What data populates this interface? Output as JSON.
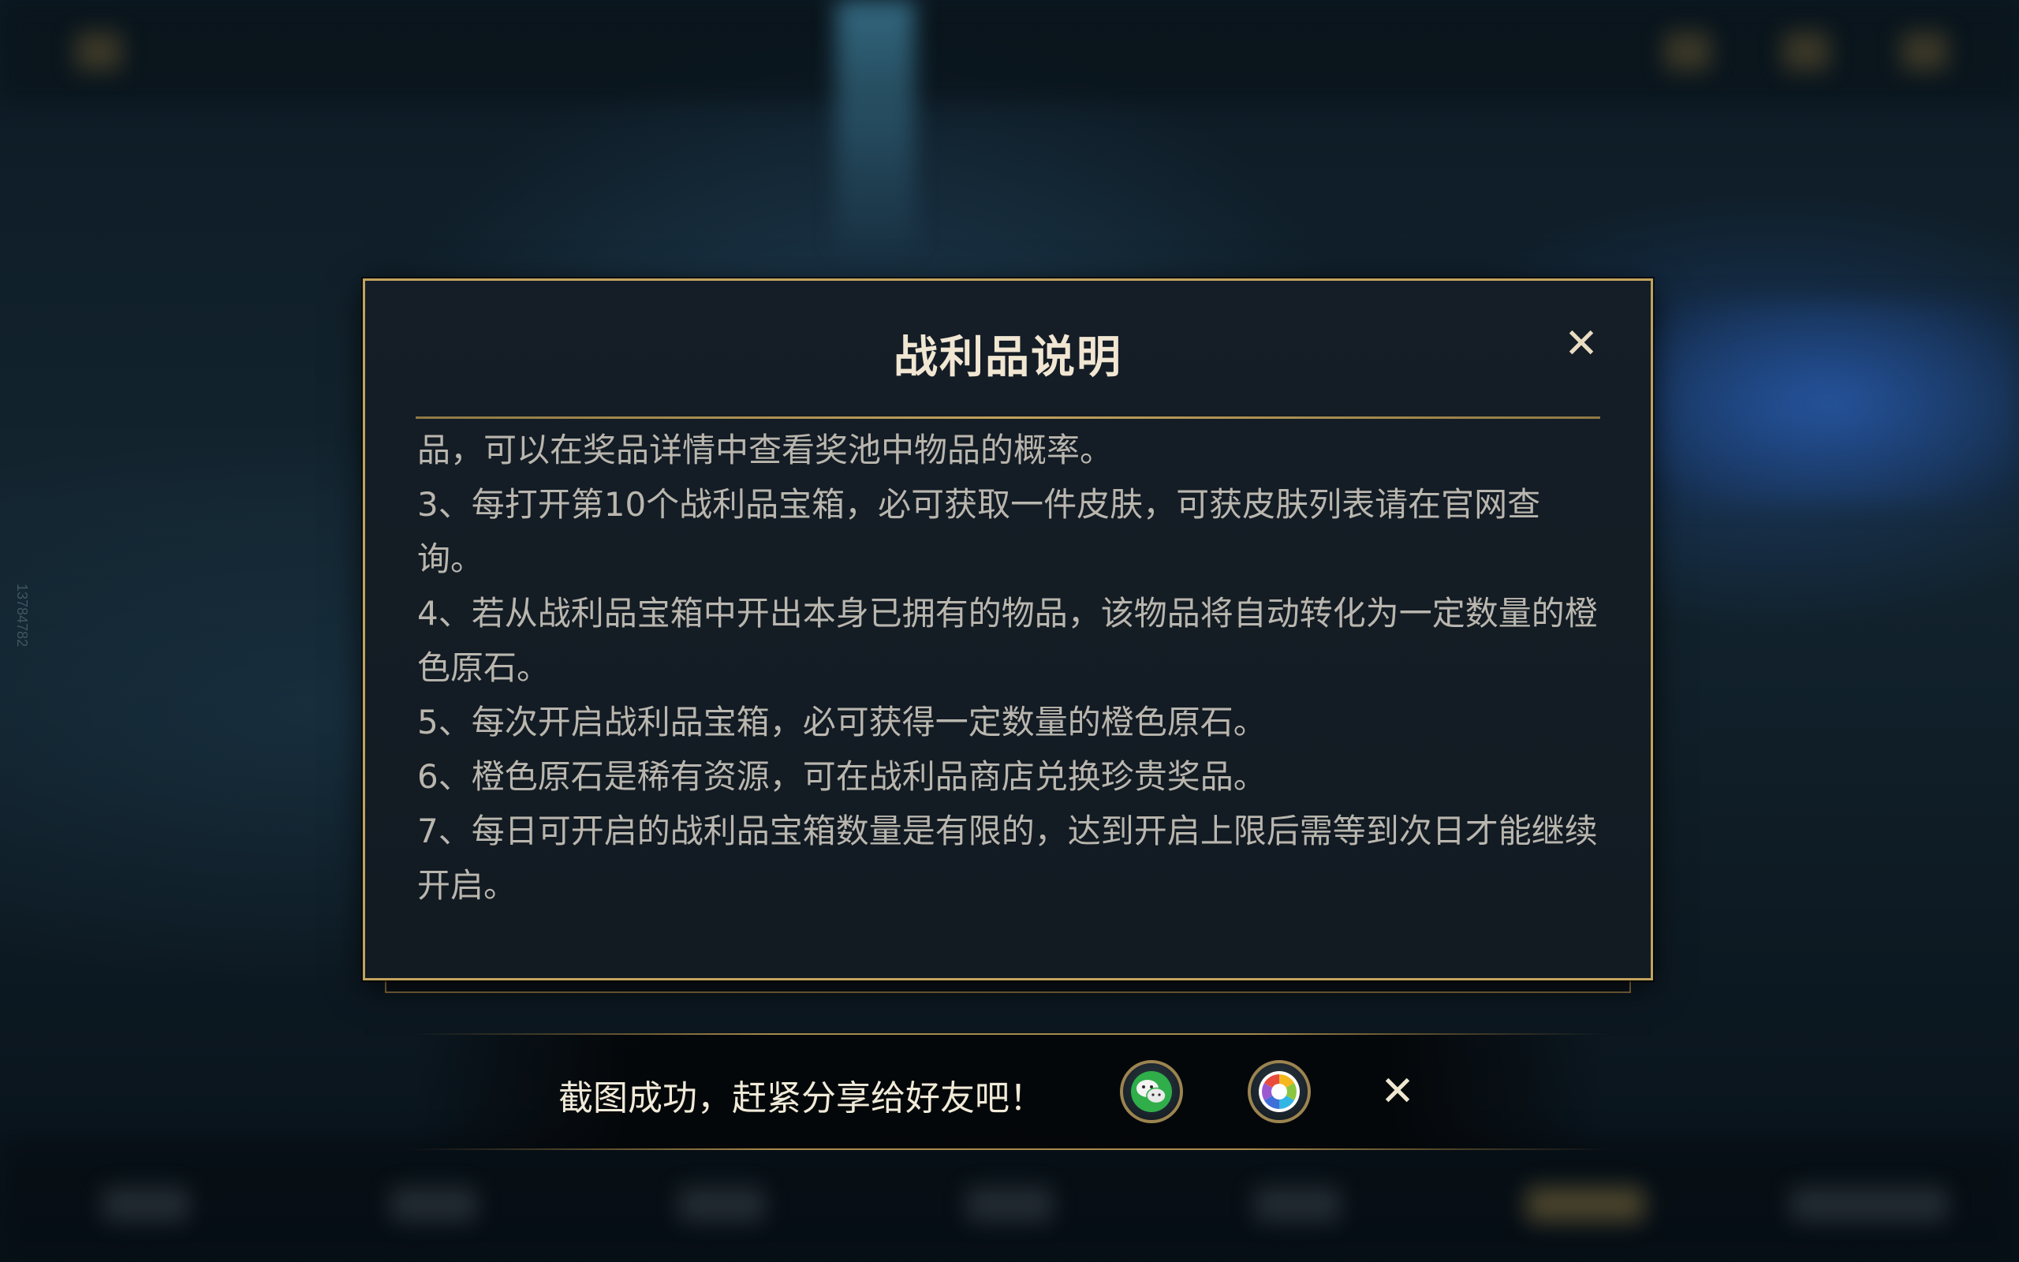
{
  "background": {
    "side_id": "13784782"
  },
  "dialog": {
    "title": "战利品说明",
    "close_icon": "close-icon",
    "lines": [
      "品，可以在奖品详情中查看奖池中物品的概率。",
      "3、每打开第10个战利品宝箱，必可获取一件皮肤，可获皮肤列表请在官网查询。",
      "4、若从战利品宝箱中开出本身已拥有的物品，该物品将自动转化为一定数量的橙色原石。",
      "5、每次开启战利品宝箱，必可获得一定数量的橙色原石。",
      "6、橙色原石是稀有资源，可在战利品商店兑换珍贵奖品。",
      "7、每日可开启的战利品宝箱数量是有限的，达到开启上限后需等到次日才能继续开启。"
    ]
  },
  "share_bar": {
    "message": "截图成功，赶紧分享给好友吧！",
    "buttons": [
      {
        "icon": "wechat-icon"
      },
      {
        "icon": "moments-icon"
      }
    ],
    "close_icon": "close-icon"
  },
  "colors": {
    "gold_border": "#c2a35d",
    "title_text": "#f0e6d2",
    "body_text": "#b9b6ae"
  }
}
